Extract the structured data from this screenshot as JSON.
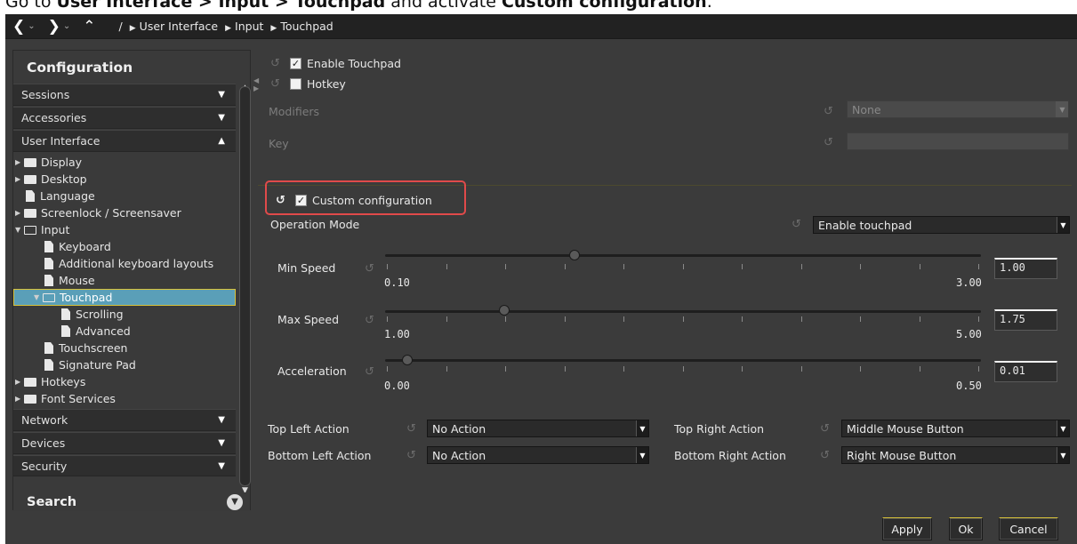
{
  "instruction": {
    "prefix": "Go to ",
    "path": "User Interface > Input > Touchpad",
    "middle": " and activate ",
    "target": "Custom configuration",
    "suffix": "."
  },
  "topbar": {
    "back_icon": "chevron-left-icon",
    "forward_icon": "chevron-right-icon",
    "up_icon": "chevron-up-icon",
    "root": "/",
    "crumbs": [
      "User Interface",
      "Input",
      "Touchpad"
    ]
  },
  "sidebar": {
    "title": "Configuration",
    "sections": {
      "sessions": "Sessions",
      "accessories": "Accessories",
      "user_interface": "User Interface",
      "network": "Network",
      "devices": "Devices",
      "security": "Security"
    },
    "tree": {
      "display": "Display",
      "desktop": "Desktop",
      "language": "Language",
      "screenlock": "Screenlock / Screensaver",
      "input": "Input",
      "keyboard": "Keyboard",
      "additional_keyboard": "Additional keyboard layouts",
      "mouse": "Mouse",
      "touchpad": "Touchpad",
      "scrolling": "Scrolling",
      "advanced": "Advanced",
      "touchscreen": "Touchscreen",
      "signature_pad": "Signature Pad",
      "hotkeys": "Hotkeys",
      "font_services": "Font Services"
    },
    "search": "Search"
  },
  "main": {
    "enable_touchpad": {
      "label": "Enable Touchpad",
      "checked": true
    },
    "hotkey": {
      "label": "Hotkey",
      "checked": false
    },
    "modifiers": {
      "label": "Modifiers",
      "value": "None"
    },
    "key": {
      "label": "Key",
      "value": ""
    },
    "custom_configuration": {
      "label": "Custom configuration",
      "checked": true
    },
    "operation_mode": {
      "label": "Operation Mode",
      "value": "Enable touchpad"
    },
    "min_speed": {
      "label": "Min Speed",
      "min": "0.10",
      "max": "3.00",
      "value": "1.00"
    },
    "max_speed": {
      "label": "Max Speed",
      "min": "1.00",
      "max": "5.00",
      "value": "1.75"
    },
    "acceleration": {
      "label": "Acceleration",
      "min": "0.00",
      "max": "0.50",
      "value": "0.01"
    },
    "top_left_action": {
      "label": "Top Left Action",
      "value": "No Action"
    },
    "bottom_left_action": {
      "label": "Bottom Left Action",
      "value": "No Action"
    },
    "top_right_action": {
      "label": "Top Right Action",
      "value": "Middle Mouse Button"
    },
    "bottom_right_action": {
      "label": "Bottom Right Action",
      "value": "Right Mouse Button"
    }
  },
  "buttons": {
    "apply": "Apply",
    "ok": "Ok",
    "cancel": "Cancel"
  },
  "colors": {
    "highlight_border": "#e04a4a",
    "selection": "#5a9fb8",
    "accent": "#d8c23a"
  }
}
